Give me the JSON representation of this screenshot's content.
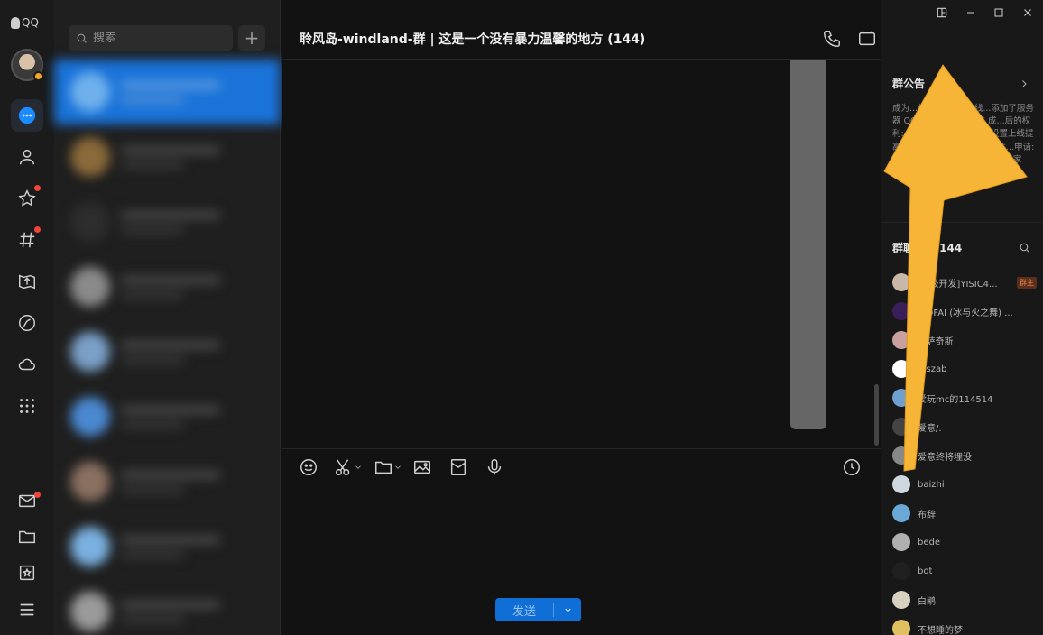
{
  "app": {
    "brand": "QQ"
  },
  "rail": {
    "items": [
      "messages-icon",
      "contacts-icon",
      "favorites-icon",
      "channels-icon",
      "games-icon",
      "apps-icon",
      "cloud-icon",
      "more-apps-icon"
    ],
    "bottom": [
      "mail-icon",
      "folder-icon",
      "bookmark-icon",
      "menu-icon"
    ]
  },
  "search": {
    "placeholder": "搜索"
  },
  "chat": {
    "title": "聆风岛-windland-群 | 这是一个没有暴力温馨的地方 (144)",
    "send_label": "发送"
  },
  "notice": {
    "title": "群公告",
    "body": "成为...件: 1.服务器在线...添加了服务器 QQ群...器视频三连过 成...后的权利: 1.地皮领取...1块 2.家设置上线提高...正很牛逼就对了 满足条件...申请: 私信群主/管理, ...格式信息 \"[玩家名..."
  },
  "members": {
    "title": "群聊成员 144",
    "owner_badge": "群主",
    "list": [
      {
        "name": "[...级开发]YISIC4...",
        "owner": true,
        "color": "#c9b8a8"
      },
      {
        "name": "...OFAI (冰与火之舞) ...",
        "owner": false,
        "color": "#3a1e5a"
      },
      {
        "name": "...萨奇斯",
        "owner": false,
        "color": "#c9a0a0"
      },
      {
        "name": "...szab",
        "owner": false,
        "color": "#ffffff"
      },
      {
        "name": "爱玩mc的114514",
        "owner": false,
        "color": "#6fa0d0"
      },
      {
        "name": "爱意/.",
        "owner": false,
        "color": "#444444"
      },
      {
        "name": "爱意终将埋没",
        "owner": false,
        "color": "#888888"
      },
      {
        "name": "baizhi",
        "owner": false,
        "color": "#cfd8e0"
      },
      {
        "name": "布辞",
        "owner": false,
        "color": "#6aa8d8"
      },
      {
        "name": "bede",
        "owner": false,
        "color": "#b0b0b0"
      },
      {
        "name": "bot",
        "owner": false,
        "color": "#202020"
      },
      {
        "name": "白鹇",
        "owner": false,
        "color": "#d8d0c0"
      },
      {
        "name": "不想睡的梦",
        "owner": false,
        "color": "#e0c060"
      }
    ]
  },
  "colors": {
    "accent": "#0f6fd6",
    "arrow": "#f7b538",
    "badge_red": "#f0463a"
  }
}
